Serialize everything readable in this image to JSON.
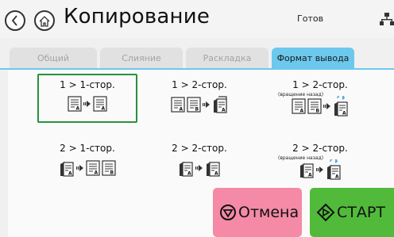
{
  "header": {
    "title": "Копирование",
    "status": "Готов",
    "icons": {
      "back": "back-arrow-icon",
      "home": "home-icon",
      "network": "network-icon"
    }
  },
  "tabs": [
    {
      "label": "Общий",
      "active": false
    },
    {
      "label": "Слияние",
      "active": false
    },
    {
      "label": "Раскладка",
      "active": false
    },
    {
      "label": "Формат вывода",
      "active": true
    }
  ],
  "options": [
    {
      "label": "1 > 1-стор.",
      "sub": "",
      "selected": true
    },
    {
      "label": "1 > 2-стор.",
      "sub": "",
      "selected": false
    },
    {
      "label": "1 > 2-стор.",
      "sub": "(вращение назад)",
      "selected": false
    },
    {
      "label": "2 > 1-стор.",
      "sub": "",
      "selected": false
    },
    {
      "label": "2 > 2-стор.",
      "sub": "",
      "selected": false
    },
    {
      "label": "2 > 2-стор.",
      "sub": "(вращение назад)",
      "selected": false
    }
  ],
  "buttons": {
    "cancel": "Отмена",
    "start": "СТАРТ"
  },
  "colors": {
    "active_tab": "#6cc8ed",
    "selected_border": "#27913f",
    "cancel_bg": "#f48aa6",
    "start_bg": "#52ba3a"
  }
}
